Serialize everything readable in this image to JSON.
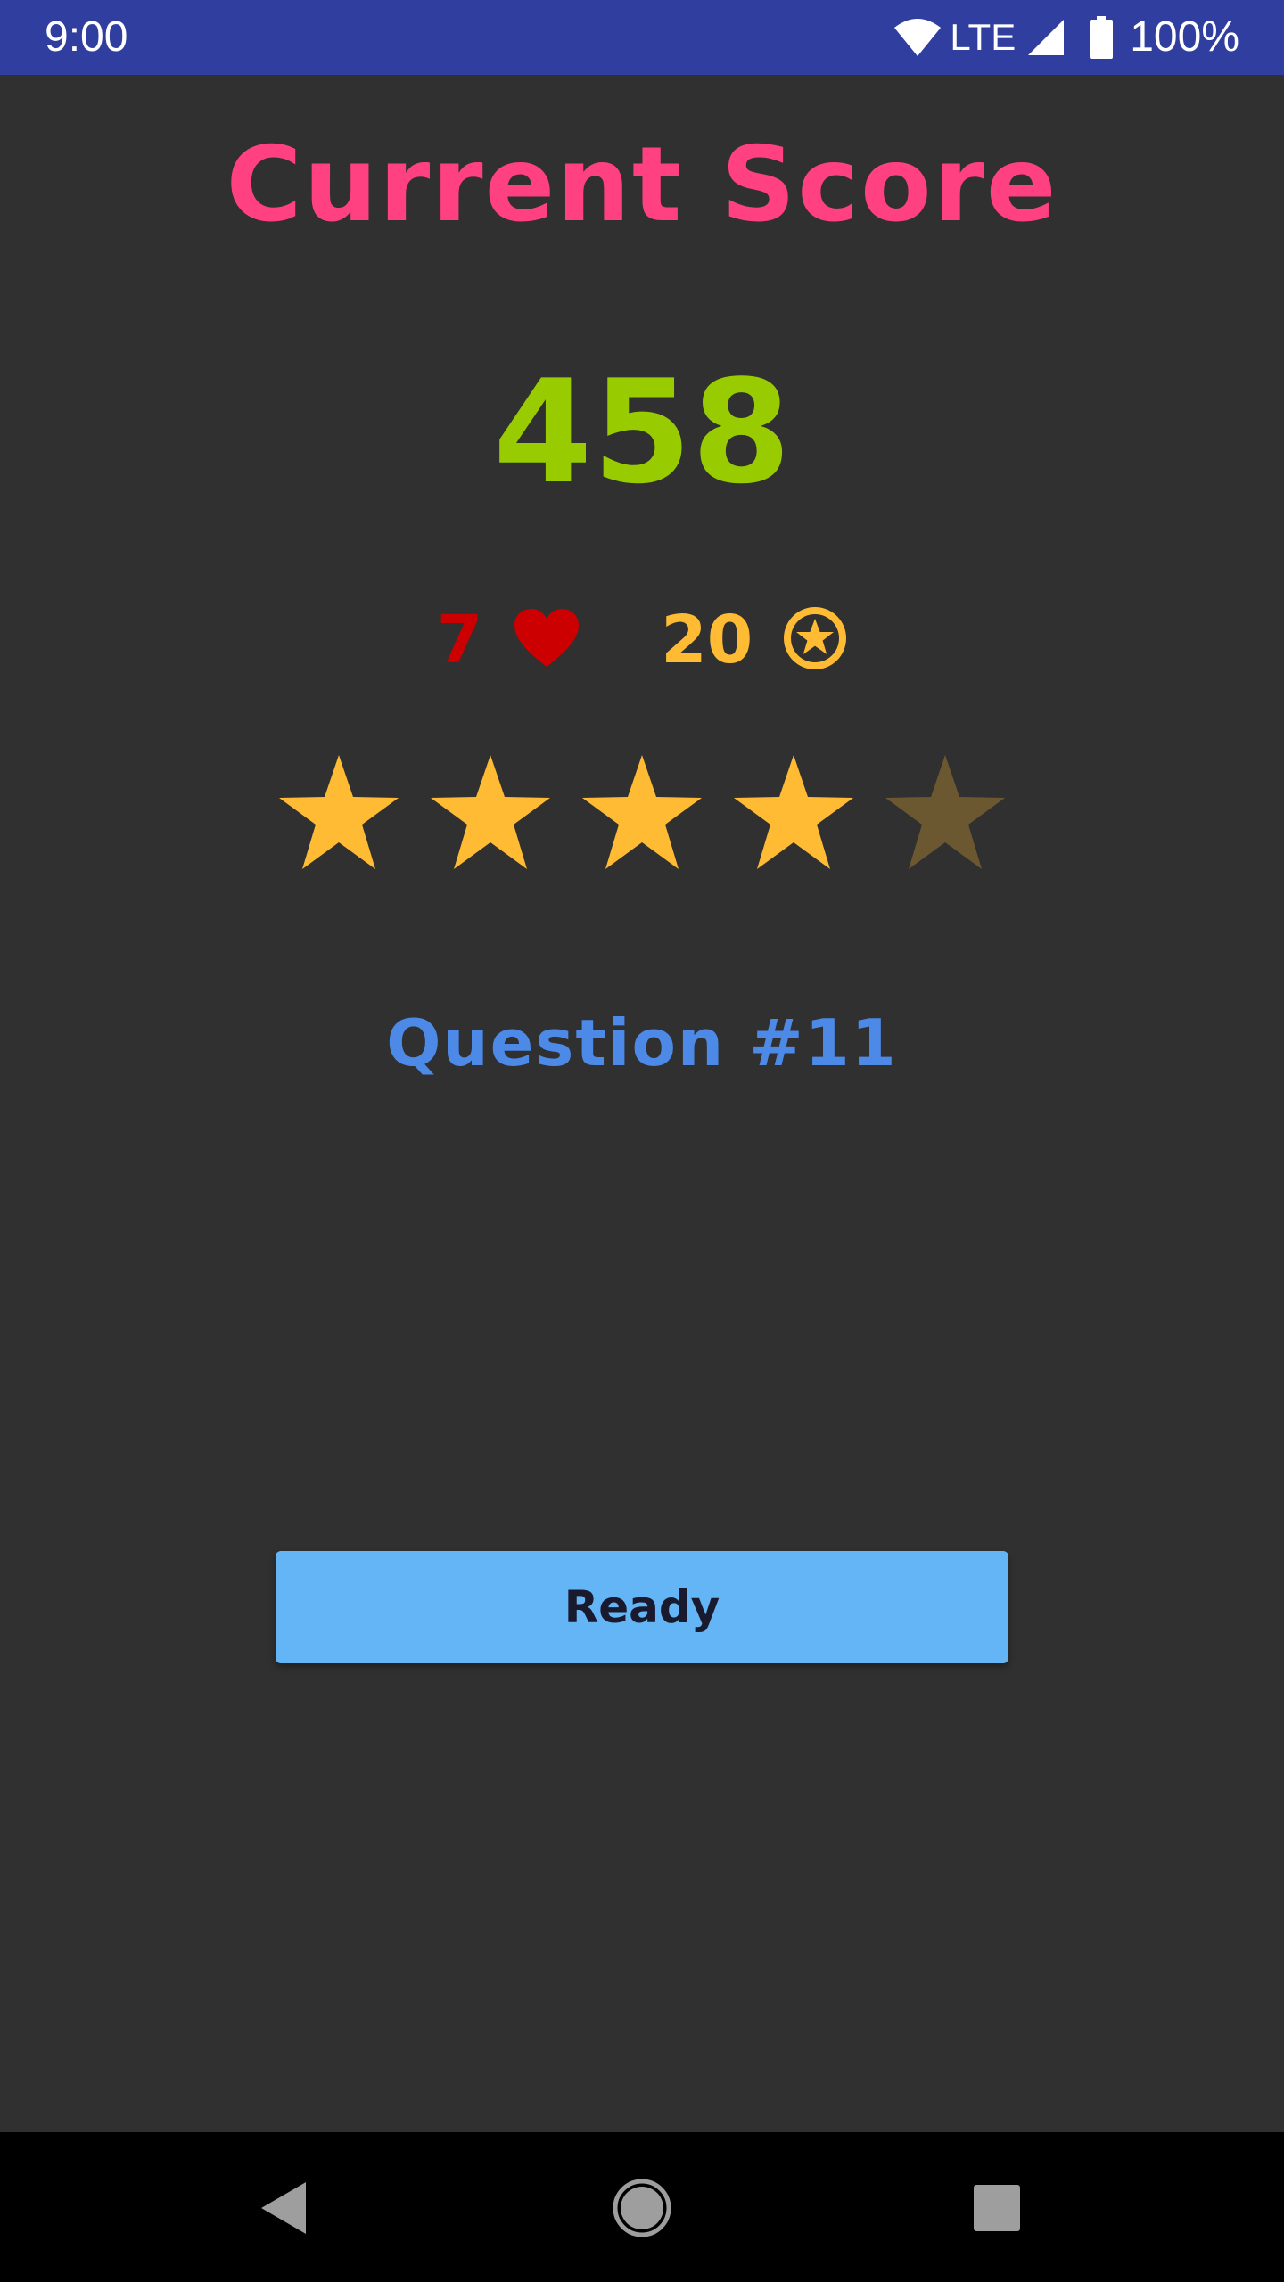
{
  "status_bar": {
    "time": "9:00",
    "network": "LTE",
    "battery": "100%",
    "background": "#303F9F",
    "icons": [
      "wifi-icon",
      "cell-signal-icon",
      "battery-icon"
    ]
  },
  "heading": {
    "text": "Current Score",
    "color": "#FF4081"
  },
  "score": {
    "value": "458",
    "color": "#99CC00"
  },
  "stats": {
    "lives": {
      "value": "7",
      "icon": "heart-icon",
      "color": "#CC0000"
    },
    "coins": {
      "value": "20",
      "icon": "star-coin-icon",
      "color": "#FFBB33"
    }
  },
  "rating": {
    "filled": 4,
    "total": 5,
    "filled_color": "#FFBB33",
    "empty_color": "#6B5830"
  },
  "question": {
    "text": "Question #11",
    "color": "#4D8AE8"
  },
  "ready_button": {
    "label": "Ready",
    "background": "#64B5F6",
    "color": "#1A1A2E"
  },
  "nav_bar": {
    "icons": [
      "back-icon",
      "home-icon",
      "recents-icon"
    ]
  }
}
